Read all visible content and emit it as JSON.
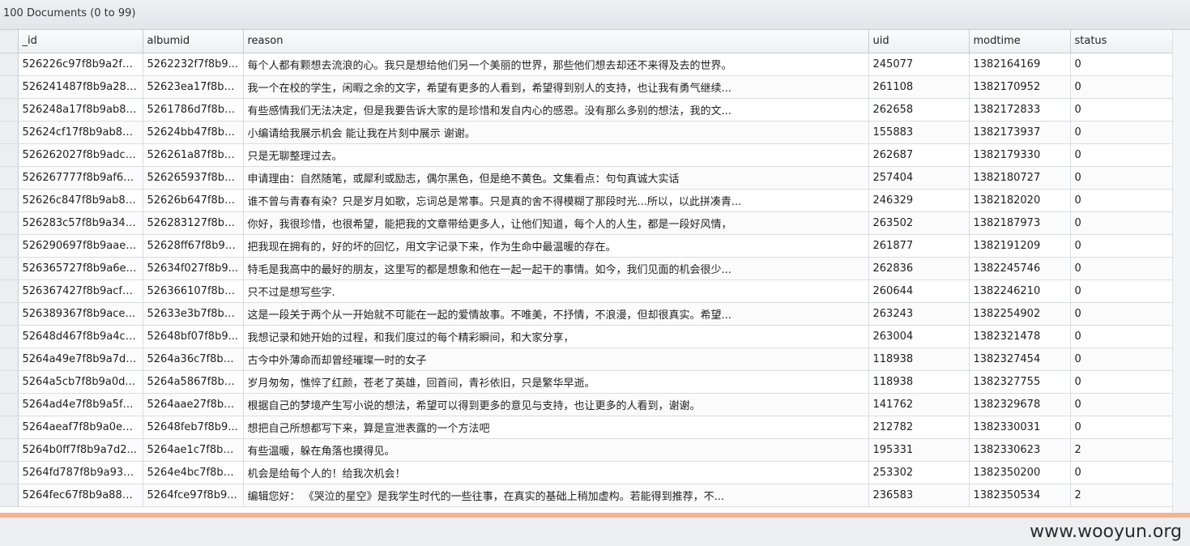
{
  "status_bar": {
    "document_count": "100 Documents (0 to 99)"
  },
  "columns": [
    "_id",
    "albumid",
    "reason",
    "uid",
    "modtime",
    "status"
  ],
  "rows": [
    [
      "526226c97f8b9a2f5...",
      "5262232f7f8b9...",
      "每个人都有颗想去流浪的心。我只是想给他们另一个美丽的世界，那些他们想去却还不来得及去的世界。",
      "245077",
      "1382164169",
      "0"
    ],
    [
      "526241487f8b9a285...",
      "52623ea17f8b9...",
      "我一个在校的学生，闲暇之余的文字，希望有更多的人看到，希望得到别人的支持，也让我有勇气继续...",
      "261108",
      "1382170952",
      "0"
    ],
    [
      "526248a17f8b9ab85...",
      "5261786d7f8b9...",
      "有些感情我们无法决定，但是我要告诉大家的是珍惜和发自内心的感恩。没有那么多别的想法，我的文...",
      "262658",
      "1382172833",
      "0"
    ],
    [
      "52624cf17f8b9ab80...",
      "52624bb47f8b9...",
      "小编请给我展示机会  能让我在片刻中展示    谢谢。",
      "155883",
      "1382173937",
      "0"
    ],
    [
      "526262027f8b9adc3...",
      "526261a87f8b9...",
      "只是无聊整理过去。",
      "262687",
      "1382179330",
      "0"
    ],
    [
      "526267777f8b9af67...",
      "526265937f8b9...",
      "申请理由：自然随笔，或犀利或励志，偶尔黑色，但是绝不黄色。文集看点：句句真诚大实话",
      "257404",
      "1382180727",
      "0"
    ],
    [
      "52626c847f8b9ab85...",
      "52626b647f8b9...",
      "谁不曾与青春有染？只是岁月如歌，忘词总是常事。只是真的舍不得模糊了那段时光...所以，以此拼凑青...",
      "246329",
      "1382182020",
      "0"
    ],
    [
      "526283c57f8b9a345...",
      "526283127f8b9...",
      "你好，我很珍惜，也很希望，能把我的文章带给更多人，让他们知道，每个人的人生，都是一段好风情，",
      "263502",
      "1382187973",
      "0"
    ],
    [
      "526290697f8b9aae3...",
      "52628ff67f8b9a...",
      "把我现在拥有的，好的坏的回忆，用文字记录下来，作为生命中最温暖的存在。",
      "261877",
      "1382191209",
      "0"
    ],
    [
      "526365727f8b9a6e1...",
      "52634f027f8b9...",
      "特毛是我高中的最好的朋友，这里写的都是想象和他在一起一起干的事情。如今，我们见面的机会很少...",
      "262836",
      "1382245746",
      "0"
    ],
    [
      "526367427f8b9acf7...",
      "526366107f8b9...",
      "只不过是想写些字.",
      "260644",
      "1382246210",
      "0"
    ],
    [
      "526389367f8b9ace7...",
      "52633e3b7f8b9...",
      "这是一段关于两个从一开始就不可能在一起的爱情故事。不唯美，不抒情，不浪漫，但却很真实。希望...",
      "263243",
      "1382254902",
      "0"
    ],
    [
      "52648d467f8b9a4c1...",
      "52648bf07f8b9...",
      "我想记录和她开始的过程，和我们度过的每个精彩瞬间，和大家分享，",
      "263004",
      "1382321478",
      "0"
    ],
    [
      "5264a49e7f8b9a7d2...",
      "5264a36c7f8b9...",
      "古今中外薄命而却曾经璀璨一时的女子",
      "118938",
      "1382327454",
      "0"
    ],
    [
      "5264a5cb7f8b9a0d...",
      "5264a5867f8b9...",
      "岁月匆匆，憔悴了红颜，苍老了英雄，回首间，青衫依旧，只是繁华早逝。",
      "118938",
      "1382327755",
      "0"
    ],
    [
      "5264ad4e7f8b9a5f1...",
      "5264aae27f8b9...",
      "根据自己的梦境产生写小说的想法，希望可以得到更多的意见与支持，也让更多的人看到，谢谢。",
      "141762",
      "1382329678",
      "0"
    ],
    [
      "5264aeaf7f8b9a0e1...",
      "52648feb7f8b9...",
      "想把自己所想都写下来，算是宣泄表露的一个方法吧",
      "212782",
      "1382330031",
      "0"
    ],
    [
      "5264b0ff7f8b9a7d2...",
      "5264ae1c7f8b9...",
      "有些温暖，躲在角落也摸得见。",
      "195331",
      "1382330623",
      "2"
    ],
    [
      "5264fd787f8b9a931...",
      "5264e4bc7f8b9...",
      "机会是给每个人的！给我次机会！",
      "253302",
      "1382350200",
      "0"
    ],
    [
      "5264fec67f8b9a881...",
      "5264fce97f8b9...",
      "编辑您好：  《哭泣的星空》是我学生时代的一些往事，在真实的基础上稍加虚构。若能得到推荐，不...",
      "236583",
      "1382350534",
      "2"
    ]
  ],
  "watermark": "www.wooyun.org",
  "colors": {
    "accent_line": "#f4b393",
    "header_bg": "#eef0f2",
    "grid_line": "#d9dce0"
  }
}
